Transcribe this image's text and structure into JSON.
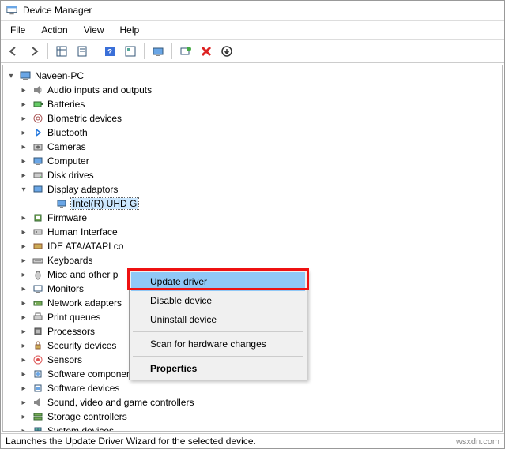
{
  "window": {
    "title": "Device Manager"
  },
  "menu": {
    "file": "File",
    "action": "Action",
    "view": "View",
    "help": "Help"
  },
  "toolbar_icons": {
    "back": "back-arrow",
    "forward": "forward-arrow",
    "show_hidden": "show-hidden",
    "properties": "properties",
    "help": "help",
    "update": "refresh",
    "monitor": "monitor",
    "scan": "scan-hardware",
    "delete": "delete",
    "uninstall": "uninstall"
  },
  "root": {
    "label": "Naveen-PC"
  },
  "devices": [
    {
      "label": "Audio inputs and outputs",
      "icon": "audio"
    },
    {
      "label": "Batteries",
      "icon": "battery"
    },
    {
      "label": "Biometric devices",
      "icon": "biometric"
    },
    {
      "label": "Bluetooth",
      "icon": "bluetooth"
    },
    {
      "label": "Cameras",
      "icon": "camera"
    },
    {
      "label": "Computer",
      "icon": "computer"
    },
    {
      "label": "Disk drives",
      "icon": "disk"
    },
    {
      "label": "Display adaptors",
      "icon": "display",
      "expanded": true,
      "children": [
        {
          "label": "Intel(R) UHD Graphics",
          "icon": "display",
          "selected": true,
          "truncated": "Intel(R) UHD G"
        }
      ]
    },
    {
      "label": "Firmware",
      "icon": "firmware",
      "truncated": "Firmware"
    },
    {
      "label": "Human Interface Devices",
      "icon": "hid",
      "truncated": "Human Interface"
    },
    {
      "label": "IDE ATA/ATAPI controllers",
      "icon": "ide",
      "truncated": "IDE ATA/ATAPI co"
    },
    {
      "label": "Keyboards",
      "icon": "keyboard"
    },
    {
      "label": "Mice and other pointing devices",
      "icon": "mouse",
      "truncated": "Mice and other p"
    },
    {
      "label": "Monitors",
      "icon": "monitor"
    },
    {
      "label": "Network adapters",
      "icon": "network",
      "truncated": "Network adapters"
    },
    {
      "label": "Print queues",
      "icon": "printer"
    },
    {
      "label": "Processors",
      "icon": "cpu"
    },
    {
      "label": "Security devices",
      "icon": "security"
    },
    {
      "label": "Sensors",
      "icon": "sensor"
    },
    {
      "label": "Software components",
      "icon": "swcomp"
    },
    {
      "label": "Software devices",
      "icon": "swdev"
    },
    {
      "label": "Sound, video and game controllers",
      "icon": "sound"
    },
    {
      "label": "Storage controllers",
      "icon": "storage"
    },
    {
      "label": "System devices",
      "icon": "system",
      "truncated": "System devices"
    }
  ],
  "context_menu": {
    "items": [
      {
        "label": "Update driver",
        "highlighted": true
      },
      {
        "label": "Disable device"
      },
      {
        "label": "Uninstall device"
      },
      {
        "sep": true
      },
      {
        "label": "Scan for hardware changes"
      },
      {
        "sep": true
      },
      {
        "label": "Properties",
        "bold": true
      }
    ]
  },
  "statusbar": "Launches the Update Driver Wizard for the selected device.",
  "watermark": "wsxdn.com"
}
